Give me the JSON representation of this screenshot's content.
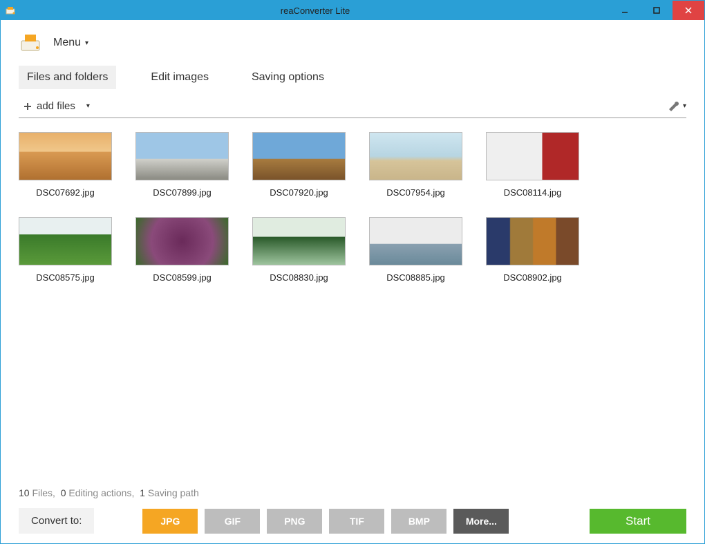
{
  "window": {
    "title": "reaConverter Lite"
  },
  "menu": {
    "label": "Menu"
  },
  "tabs": [
    {
      "label": "Files and folders",
      "active": true
    },
    {
      "label": "Edit images",
      "active": false
    },
    {
      "label": "Saving options",
      "active": false
    }
  ],
  "toolbar": {
    "add_files": "add files"
  },
  "thumbs": [
    {
      "name": "DSC07692.jpg",
      "bg": "linear-gradient(180deg,#e8b06a 0%,#f0c78a 40%,#d99a52 41%,#b07030 100%)"
    },
    {
      "name": "DSC07899.jpg",
      "bg": "linear-gradient(180deg,#9ec6e6 0%,#9ec6e6 55%,#cfcfc9 56%,#8a8a82 100%)"
    },
    {
      "name": "DSC07920.jpg",
      "bg": "linear-gradient(180deg,#6fa8d8 0%,#6fa8d8 55%,#a77b3f 56%,#7a532a 100%)"
    },
    {
      "name": "DSC07954.jpg",
      "bg": "linear-gradient(180deg,#cfe6f0 0%,#b7d5e2 50%,#d6c49a 60%,#c9b58a 100%)"
    },
    {
      "name": "DSC08114.jpg",
      "bg": "linear-gradient(90deg,#efefef 0%,#efefef 60%,#b02828 61%,#b02828 100%)"
    },
    {
      "name": "DSC08575.jpg",
      "bg": "linear-gradient(180deg,#e8f0f0 0%,#e8f0f0 35%,#3a7a2a 36%,#5a9a3a 100%)"
    },
    {
      "name": "DSC08599.jpg",
      "bg": "radial-gradient(circle,#6a2a5a 0%,#8a4a7a 60%,#3a6a2a 100%)"
    },
    {
      "name": "DSC08830.jpg",
      "bg": "linear-gradient(180deg,#e0ece0 0%,#e0ece0 40%,#2a5a2a 41%,#9ec49e 100%)"
    },
    {
      "name": "DSC08885.jpg",
      "bg": "linear-gradient(180deg,#ececec 0%,#ececec 55%,#8aa0b0 56%,#6a8a9a 100%)"
    },
    {
      "name": "DSC08902.jpg",
      "bg": "linear-gradient(90deg,#2a3a6a 0%,#2a3a6a 25%,#a07a3a 26%,#a07a3a 50%,#c07a2a 51%,#c07a2a 75%,#7a4a2a 76%,#7a4a2a 100%)"
    }
  ],
  "status": {
    "files_n": "10",
    "files_t": "Files,",
    "actions_n": "0",
    "actions_t": "Editing actions,",
    "paths_n": "1",
    "paths_t": "Saving path"
  },
  "convert": {
    "label": "Convert to:",
    "formats": [
      {
        "label": "JPG",
        "sel": true
      },
      {
        "label": "GIF",
        "sel": false
      },
      {
        "label": "PNG",
        "sel": false
      },
      {
        "label": "TIF",
        "sel": false
      },
      {
        "label": "BMP",
        "sel": false
      }
    ],
    "more": "More...",
    "start": "Start"
  }
}
